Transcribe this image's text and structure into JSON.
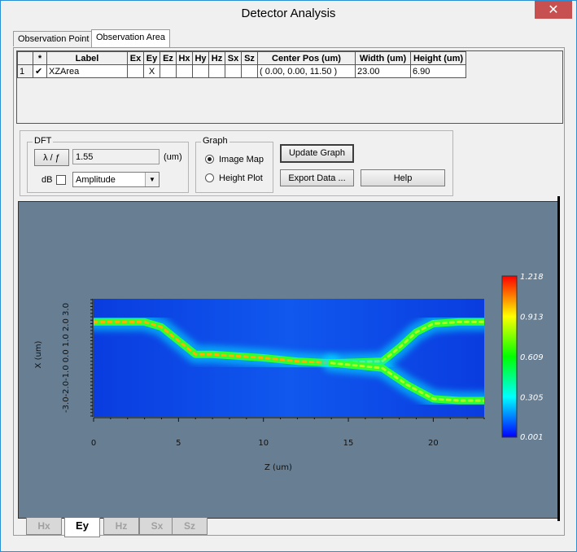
{
  "window": {
    "title": "Detector Analysis",
    "close_glyph": "✕"
  },
  "tabs": [
    "Observation Point",
    "Observation Area"
  ],
  "grid": {
    "headers": [
      "",
      "*",
      "Label",
      "Ex",
      "Ey",
      "Ez",
      "Hx",
      "Hy",
      "Hz",
      "Sx",
      "Sz",
      "Center Pos (um)",
      "Width (um)",
      "Height (um)"
    ],
    "rows": [
      {
        "index": "1",
        "checked": "✔",
        "label": "XZArea",
        "ex": "",
        "ey": "X",
        "ez": "",
        "hx": "",
        "hy": "",
        "hz": "",
        "sx": "",
        "sz": "",
        "center": "( 0.00, 0.00, 11.50 )",
        "width": "23.00",
        "height": "6.90"
      }
    ]
  },
  "dft": {
    "group_label": "DFT",
    "lambda_button": "λ / ƒ",
    "wavelength_value": "1.55",
    "unit": "(um)",
    "db_label": "dB",
    "mode_value": "Amplitude",
    "dropdown_arrow": "▼"
  },
  "graph": {
    "group_label": "Graph",
    "image_map_label": "Image Map",
    "height_plot_label": "Height Plot"
  },
  "buttons": {
    "update": "Update Graph",
    "export": "Export Data ...",
    "help": "Help"
  },
  "chart_data": {
    "type": "heatmap",
    "xlabel": "Z (um)",
    "ylabel": "X (um)",
    "x_ticks": [
      "0",
      "5",
      "10",
      "15",
      "20"
    ],
    "y_ticks": [
      "-3.0",
      "-2.0",
      "-1.0",
      "0.0",
      "1.0",
      "2.0",
      "3.0"
    ],
    "y_tick_text": "-3.0-2.0-1.0 0.0 1.0 2.0 3.0",
    "xlim": [
      0,
      23
    ],
    "ylim": [
      -3.45,
      3.45
    ],
    "colorbar_labels": [
      "1.218",
      "0.913",
      "0.609",
      "0.305",
      "0.001"
    ],
    "paths": [
      {
        "name": "input",
        "points": [
          [
            0,
            2.1
          ],
          [
            3,
            2.1
          ],
          [
            4,
            1.8
          ],
          [
            5,
            1.0
          ],
          [
            6,
            0.2
          ],
          [
            7,
            0.2
          ],
          [
            10,
            0.0
          ],
          [
            12,
            -0.2
          ],
          [
            14,
            -0.3
          ]
        ]
      },
      {
        "name": "upper-branch",
        "points": [
          [
            14,
            -0.3
          ],
          [
            17,
            -0.2
          ],
          [
            18,
            0.6
          ],
          [
            19,
            1.5
          ],
          [
            20,
            2.0
          ],
          [
            21.5,
            2.1
          ],
          [
            23,
            2.1
          ]
        ]
      },
      {
        "name": "lower-branch",
        "points": [
          [
            14,
            -0.3
          ],
          [
            17,
            -0.6
          ],
          [
            18.5,
            -1.6
          ],
          [
            20,
            -2.4
          ],
          [
            21.5,
            -2.5
          ],
          [
            23,
            -2.5
          ]
        ]
      }
    ]
  },
  "bottom_tabs": [
    "Hx",
    "Ey",
    "Hz",
    "Sx",
    "Sz"
  ],
  "colors": {
    "plot_background": "#677e93",
    "close_button": "#c75050"
  }
}
